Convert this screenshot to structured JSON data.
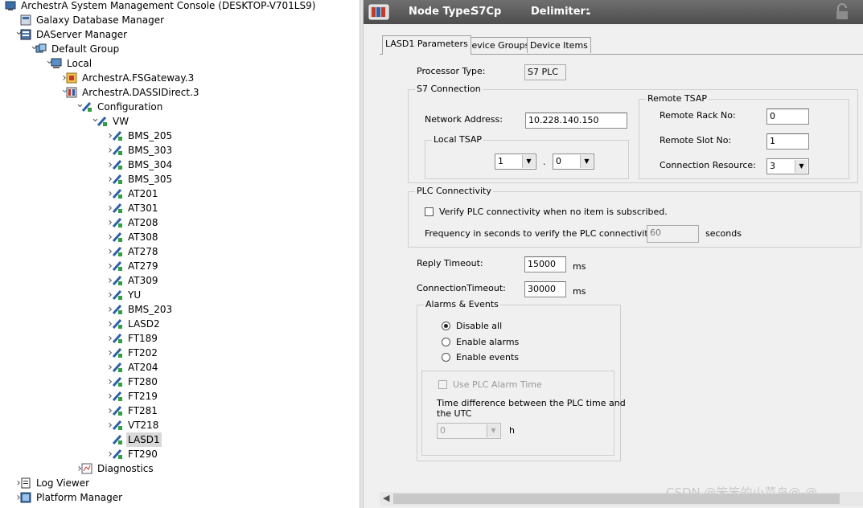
{
  "tree": {
    "items": [
      {
        "label": "ArchestrA System Management Console (DESKTOP-V701LS9)",
        "level": 0,
        "expander": "",
        "icon": "console"
      },
      {
        "label": "Galaxy Database Manager",
        "level": 1,
        "expander": "",
        "icon": "db"
      },
      {
        "label": "DAServer Manager",
        "level": 1,
        "expander": "open",
        "icon": "server"
      },
      {
        "label": "Default Group",
        "level": 2,
        "expander": "open",
        "icon": "group"
      },
      {
        "label": "Local",
        "level": 3,
        "expander": "open",
        "icon": "computer"
      },
      {
        "label": "ArchestrA.FSGateway.3",
        "level": 4,
        "expander": "closed",
        "icon": "gateway"
      },
      {
        "label": "ArchestrA.DASSIDirect.3",
        "level": 4,
        "expander": "open-blue",
        "icon": "daserver"
      },
      {
        "label": "Configuration",
        "level": 5,
        "expander": "open",
        "icon": "config"
      },
      {
        "label": "VW",
        "level": 6,
        "expander": "open",
        "icon": "device"
      },
      {
        "label": "BMS_205",
        "level": 7,
        "expander": "closed",
        "icon": "device"
      },
      {
        "label": "BMS_303",
        "level": 7,
        "expander": "closed",
        "icon": "device"
      },
      {
        "label": "BMS_304",
        "level": 7,
        "expander": "closed",
        "icon": "device"
      },
      {
        "label": "BMS_305",
        "level": 7,
        "expander": "closed",
        "icon": "device"
      },
      {
        "label": "AT201",
        "level": 7,
        "expander": "closed",
        "icon": "device"
      },
      {
        "label": "AT301",
        "level": 7,
        "expander": "closed",
        "icon": "device"
      },
      {
        "label": "AT208",
        "level": 7,
        "expander": "closed",
        "icon": "device"
      },
      {
        "label": "AT308",
        "level": 7,
        "expander": "closed",
        "icon": "device"
      },
      {
        "label": "AT278",
        "level": 7,
        "expander": "closed",
        "icon": "device"
      },
      {
        "label": "AT279",
        "level": 7,
        "expander": "closed",
        "icon": "device"
      },
      {
        "label": "AT309",
        "level": 7,
        "expander": "closed",
        "icon": "device"
      },
      {
        "label": "YU",
        "level": 7,
        "expander": "closed",
        "icon": "device"
      },
      {
        "label": "BMS_203",
        "level": 7,
        "expander": "closed",
        "icon": "device"
      },
      {
        "label": "LASD2",
        "level": 7,
        "expander": "closed",
        "icon": "device"
      },
      {
        "label": "FT189",
        "level": 7,
        "expander": "closed",
        "icon": "device"
      },
      {
        "label": "FT202",
        "level": 7,
        "expander": "closed",
        "icon": "device"
      },
      {
        "label": "AT204",
        "level": 7,
        "expander": "closed",
        "icon": "device"
      },
      {
        "label": "FT280",
        "level": 7,
        "expander": "closed",
        "icon": "device"
      },
      {
        "label": "FT219",
        "level": 7,
        "expander": "closed",
        "icon": "device"
      },
      {
        "label": "FT281",
        "level": 7,
        "expander": "closed",
        "icon": "device"
      },
      {
        "label": "VT218",
        "level": 7,
        "expander": "closed",
        "icon": "device"
      },
      {
        "label": "LASD1",
        "level": 7,
        "expander": "",
        "icon": "device",
        "selected": true
      },
      {
        "label": "FT290",
        "level": 7,
        "expander": "closed",
        "icon": "device"
      },
      {
        "label": "Diagnostics",
        "level": 5,
        "expander": "closed",
        "icon": "diag"
      },
      {
        "label": "Log Viewer",
        "level": 1,
        "expander": "closed",
        "icon": "log"
      },
      {
        "label": "Platform Manager",
        "level": 1,
        "expander": "closed",
        "icon": "platform"
      }
    ]
  },
  "header": {
    "node_type_label": "Node Type:",
    "node_type_value": "S7Cp",
    "delimiter_label": "Delimiter:",
    "delimiter_value": "."
  },
  "tabs": [
    {
      "label": "LASD1 Parameters",
      "active": true
    },
    {
      "label": "Device Groups",
      "active": false
    },
    {
      "label": "Device Items",
      "active": false
    }
  ],
  "params": {
    "processor_type_label": "Processor Type:",
    "processor_type_value": "S7 PLC",
    "s7_connection_title": "S7 Connection",
    "network_address_label": "Network Address:",
    "network_address_value": "10.228.140.150",
    "local_tsap_title": "Local TSAP",
    "local_tsap_a": "1",
    "local_tsap_sep": ".",
    "local_tsap_b": "0",
    "remote_tsap_title": "Remote TSAP",
    "remote_rack_label": "Remote Rack No:",
    "remote_rack_value": "0",
    "remote_slot_label": "Remote Slot No:",
    "remote_slot_value": "1",
    "connection_resource_label": "Connection Resource:",
    "connection_resource_value": "3",
    "plc_connectivity_title": "PLC Connectivity",
    "verify_plc_label": "Verify PLC connectivity when no item is subscribed.",
    "frequency_label": "Frequency in seconds to verify the PLC connectivity",
    "frequency_value": "60",
    "frequency_unit": "seconds",
    "reply_timeout_label": "Reply Timeout:",
    "reply_timeout_value": "15000",
    "reply_timeout_unit": "ms",
    "connection_timeout_label": "ConnectionTimeout:",
    "connection_timeout_value": "30000",
    "connection_timeout_unit": "ms",
    "alarms_events_title": "Alarms & Events",
    "radio_disable_all": "Disable all",
    "radio_enable_alarms": "Enable alarms",
    "radio_enable_events": "Enable events",
    "use_plc_alarm_time_label": "Use PLC Alarm Time",
    "time_diff_label_line1": "Time difference between the PLC time and",
    "time_diff_label_line2": "the UTC",
    "time_diff_value": "0",
    "time_diff_unit": "h"
  },
  "watermark": "CSDN @笨笨的小菜鸟@-@",
  "colors": {
    "header_bg": "#555555",
    "selection_bg": "#d9d9d9",
    "panel_bg": "#f0f0f0"
  }
}
